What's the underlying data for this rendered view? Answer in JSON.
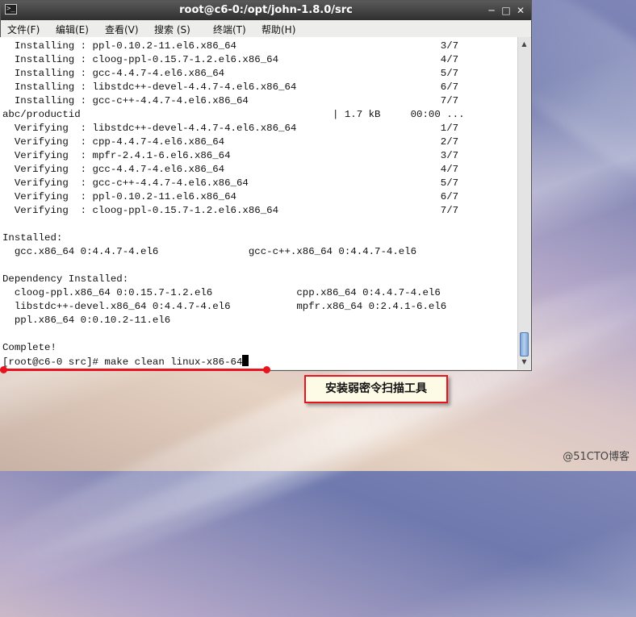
{
  "window": {
    "title": "root@c6-0:/opt/john-1.8.0/src",
    "terminal_icon": "terminal-icon",
    "controls": {
      "minimize": "─",
      "maximize": "□",
      "close": "✕"
    }
  },
  "menu": [
    "文件(F)",
    "编辑(E)",
    "查看(V)",
    "搜索 (S)",
    "终端(T)",
    "帮助(H)"
  ],
  "terminal": {
    "lines": [
      "  Installing : ppl-0.10.2-11.el6.x86_64                                  3/7",
      "  Installing : cloog-ppl-0.15.7-1.2.el6.x86_64                           4/7",
      "  Installing : gcc-4.4.7-4.el6.x86_64                                    5/7",
      "  Installing : libstdc++-devel-4.4.7-4.el6.x86_64                        6/7",
      "  Installing : gcc-c++-4.4.7-4.el6.x86_64                                7/7",
      "abc/productid                                          | 1.7 kB     00:00 ...",
      "  Verifying  : libstdc++-devel-4.4.7-4.el6.x86_64                        1/7",
      "  Verifying  : cpp-4.4.7-4.el6.x86_64                                    2/7",
      "  Verifying  : mpfr-2.4.1-6.el6.x86_64                                   3/7",
      "  Verifying  : gcc-4.4.7-4.el6.x86_64                                    4/7",
      "  Verifying  : gcc-c++-4.4.7-4.el6.x86_64                                5/7",
      "  Verifying  : ppl-0.10.2-11.el6.x86_64                                  6/7",
      "  Verifying  : cloog-ppl-0.15.7-1.2.el6.x86_64                           7/7",
      "",
      "Installed:",
      "  gcc.x86_64 0:4.4.7-4.el6               gcc-c++.x86_64 0:4.4.7-4.el6",
      "",
      "Dependency Installed:",
      "  cloog-ppl.x86_64 0:0.15.7-1.2.el6              cpp.x86_64 0:4.4.7-4.el6",
      "  libstdc++-devel.x86_64 0:4.4.7-4.el6           mpfr.x86_64 0:2.4.1-6.el6",
      "  ppl.x86_64 0:0.10.2-11.el6",
      "",
      "Complete!"
    ],
    "prompt": "[root@c6-0 src]# make clean linux-x86-64"
  },
  "annotation": {
    "callout_text": "安装弱密令扫描工具",
    "color": "#e8131d"
  },
  "watermark": "@51CTO博客"
}
